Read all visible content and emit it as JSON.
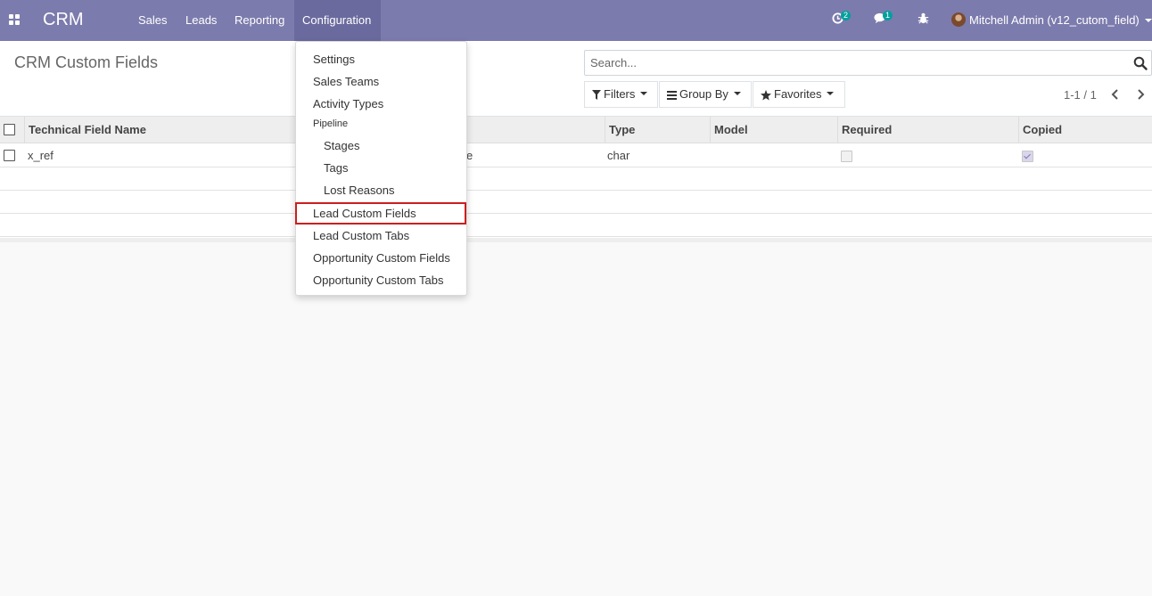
{
  "navbar": {
    "brand": "CRM",
    "menu": [
      "Sales",
      "Leads",
      "Reporting",
      "Configuration"
    ],
    "activity_count": "2",
    "message_count": "1",
    "user_name": "Mitchell Admin (v12_cutom_field)"
  },
  "control_panel": {
    "title": "CRM Custom Fields",
    "search_placeholder": "Search...",
    "filters_label": "Filters",
    "group_by_label": "Group By",
    "favorites_label": "Favorites",
    "pager_value": "1-1 / 1"
  },
  "table": {
    "columns": [
      "Technical Field Name",
      "Type",
      "Model",
      "Required",
      "Copied"
    ],
    "rows": [
      {
        "technical_name": "x_ref",
        "hidden_fragment": "e",
        "type": "char",
        "model": "",
        "required": false,
        "copied": true
      }
    ]
  },
  "configuration_menu": {
    "items": [
      {
        "label": "Settings",
        "kind": "item"
      },
      {
        "label": "Sales Teams",
        "kind": "item"
      },
      {
        "label": "Activity Types",
        "kind": "item"
      },
      {
        "label": "Pipeline",
        "kind": "header"
      },
      {
        "label": "Stages",
        "kind": "sub"
      },
      {
        "label": "Tags",
        "kind": "sub"
      },
      {
        "label": "Lost Reasons",
        "kind": "sub"
      },
      {
        "label": "Lead Custom Fields",
        "kind": "item",
        "highlighted": true
      },
      {
        "label": "Lead Custom Tabs",
        "kind": "item"
      },
      {
        "label": "Opportunity Custom Fields",
        "kind": "item"
      },
      {
        "label": "Opportunity Custom Tabs",
        "kind": "item"
      }
    ]
  },
  "colors": {
    "navbar": "#7c7bad",
    "highlight_border": "#cc1f1f",
    "badge": "#00a09d"
  }
}
